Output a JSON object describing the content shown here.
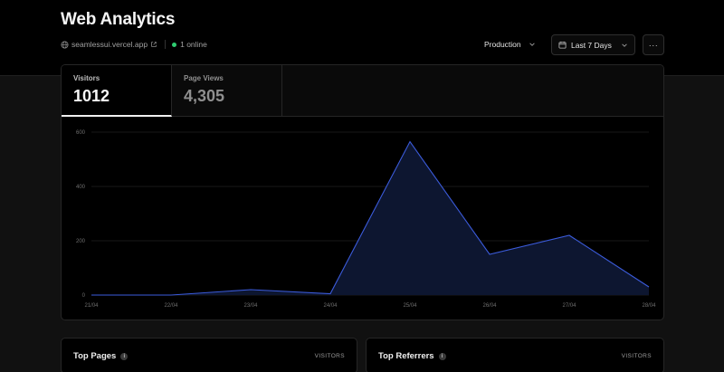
{
  "header": {
    "title": "Web Analytics",
    "site": "seamlessui.vercel.app",
    "online": "1 online",
    "environment": "Production",
    "date_range": "Last 7 Days",
    "more": "···"
  },
  "metrics": [
    {
      "label": "Visitors",
      "value": "1012"
    },
    {
      "label": "Page Views",
      "value": "4,305"
    }
  ],
  "cards": [
    {
      "title": "Top Pages",
      "column": "VISITORS",
      "info": "i"
    },
    {
      "title": "Top Referrers",
      "column": "VISITORS",
      "info": "i"
    }
  ],
  "colors": {
    "accent": "#3b5bdb",
    "online": "#2ecc71"
  },
  "chart_data": {
    "type": "area",
    "categories": [
      "21/04",
      "22/04",
      "23/04",
      "24/04",
      "25/04",
      "26/04",
      "27/04",
      "28/04"
    ],
    "values": [
      0,
      0,
      20,
      5,
      565,
      150,
      220,
      30
    ],
    "ylim": [
      0,
      600
    ],
    "yticks": [
      0,
      200,
      400,
      600
    ],
    "grid": true
  }
}
